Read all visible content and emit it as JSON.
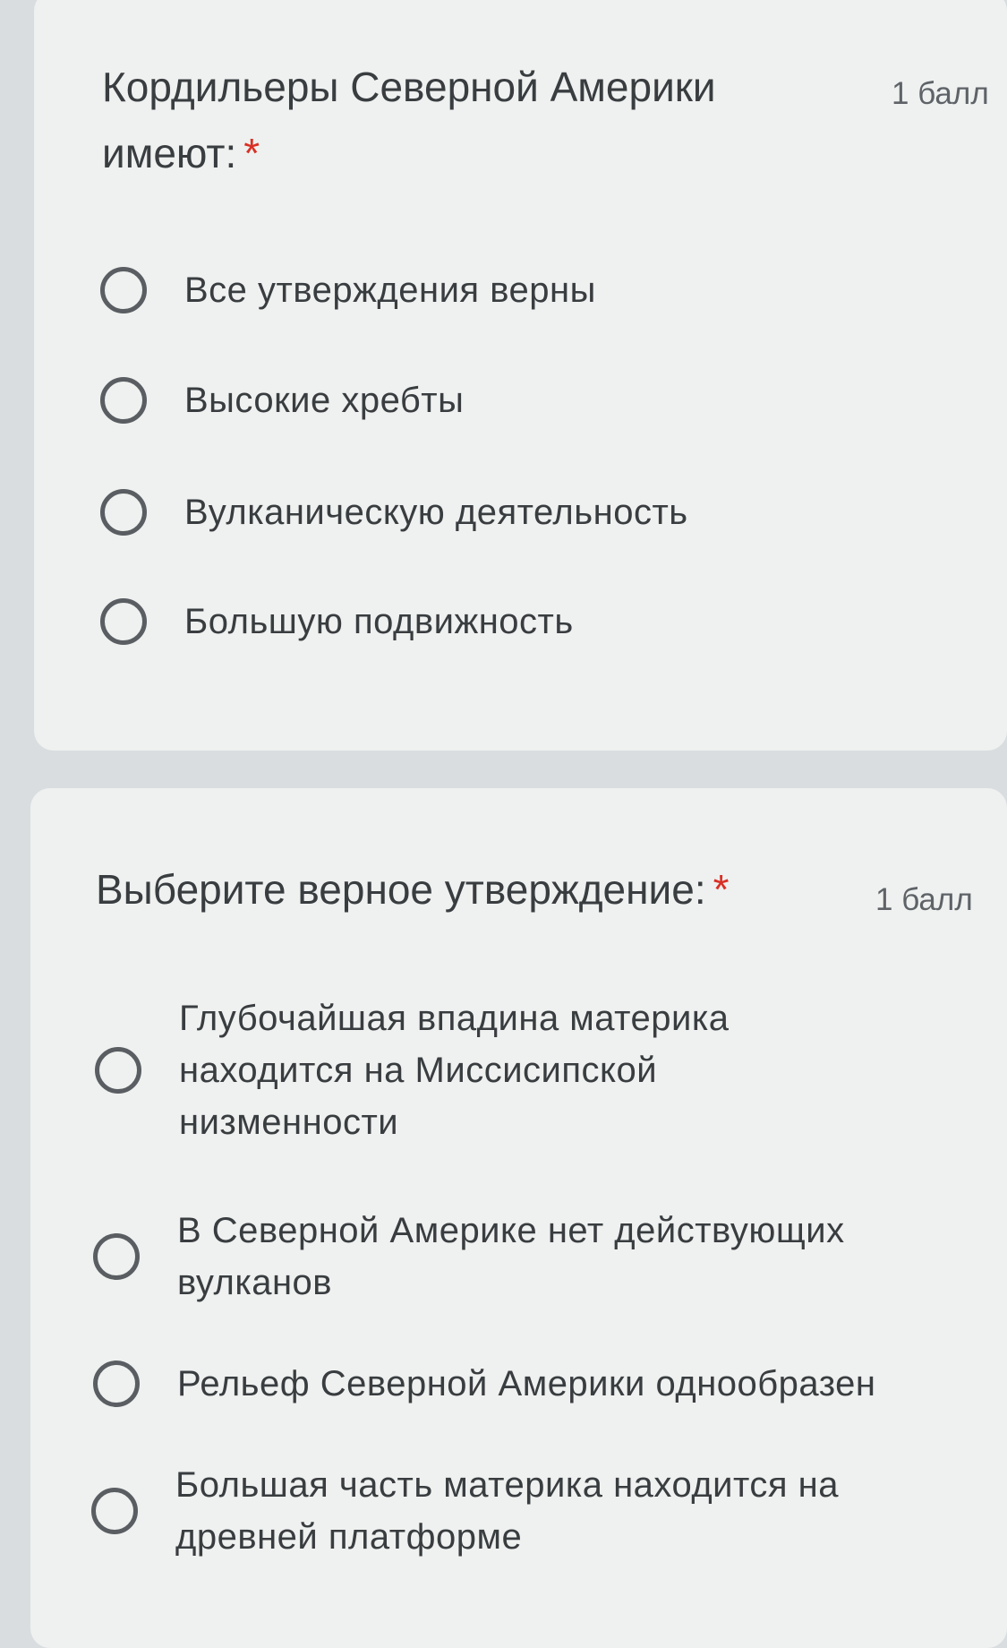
{
  "questions": [
    {
      "title": "Кордильеры Северной Америки имеют:",
      "required_mark": "*",
      "points": "1 балл",
      "options": [
        "Все утверждения верны",
        "Высокие хребты",
        "Вулканическую деятельность",
        "Большую подвижность"
      ]
    },
    {
      "title": "Выберите верное утверждение:",
      "required_mark": "*",
      "points": "1 балл",
      "options": [
        "Глубочайшая впадина материка находится на Миссисипской низменности",
        "В Северной Америке нет действующих вулканов",
        "Рельеф Северной Америки однообразен",
        "Большая часть материка находится на древней платформе"
      ]
    }
  ],
  "colors": {
    "background": "#d9dde0",
    "card": "#eef1ef",
    "text": "#3a3d40",
    "required": "#d93025",
    "radio_border": "#5a5e62"
  },
  "icons": {
    "radio": "radio-unchecked-icon"
  }
}
